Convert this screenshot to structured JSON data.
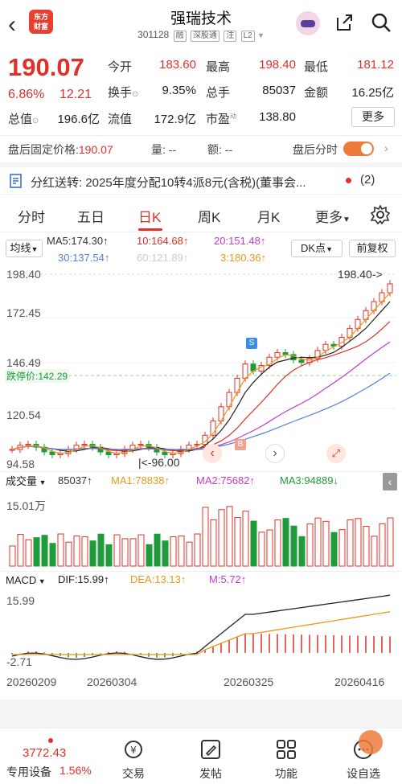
{
  "header": {
    "logo_text": "东方财富",
    "title": "强瑞技术",
    "code": "301128",
    "tags": [
      "融",
      "深股通",
      "注",
      "L2"
    ]
  },
  "quote": {
    "price": "190.07",
    "change_pct": "6.86%",
    "change_amt": "12.21",
    "open_label": "今开",
    "open": "183.60",
    "high_label": "最高",
    "high": "198.40",
    "low_label": "最低",
    "low": "181.12",
    "turnover_label": "换手",
    "turnover": "9.35%",
    "volume_label": "总手",
    "volume": "85037",
    "amount_label": "金额",
    "amount": "16.25亿",
    "mcap_label": "总值",
    "mcap": "196.6亿",
    "float_label": "流值",
    "float": "172.9亿",
    "pe_label": "市盈",
    "pe_sup": "动",
    "pe": "138.80",
    "more": "更多"
  },
  "after_hours": {
    "fixed_price_label": "盘后固定价格:",
    "fixed_price": "190.07",
    "vol_label": "量:",
    "vol": "--",
    "amt_label": "额:",
    "amt": "--",
    "timeshare_label": "盘后分时"
  },
  "notice": {
    "text": "分红送转: 2025年度分配10转4派8元(含税)(董事会...",
    "count": "(2)"
  },
  "tabs": [
    "分时",
    "五日",
    "日K",
    "周K",
    "月K",
    "更多"
  ],
  "ma": {
    "selector": "均线",
    "ma5": "MA5:174.30↑",
    "ma10": "10:164.68↑",
    "ma20": "20:151.48↑",
    "ma30": "30:137.54↑",
    "ma60": "60:121.89↑",
    "ma3": "3:180.36↑",
    "dk": "DK点",
    "adjust": "前复权"
  },
  "kline_axis": {
    "y_labels": [
      "198.40",
      "172.45",
      "146.49",
      "120.54",
      "94.58"
    ],
    "high_marker": "198.40->",
    "low_marker": "|<-96.00",
    "limit_price": "跌停价:142.29"
  },
  "volume": {
    "selector": "成交量",
    "value": "85037↑",
    "ma1": "MA1:78838↑",
    "ma2": "MA2:75682↑",
    "ma3": "MA3:94889↓",
    "max_label": "15.01万"
  },
  "macd": {
    "selector": "MACD",
    "dif": "DIF:15.99↑",
    "dea": "DEA:13.13↑",
    "m": "M:5.72↑",
    "top_label": "15.99",
    "bottom_label": "-2.71"
  },
  "dates": [
    "20260209",
    "20260304",
    "20260325",
    "20260416"
  ],
  "bottom_nav": {
    "index_value": "3772.43",
    "index_name": "专用设备",
    "index_pct": "1.56%",
    "items": [
      "交易",
      "发帖",
      "功能",
      "设自选"
    ]
  },
  "colors": {
    "up": "#e0302a",
    "down": "#1e9c3a",
    "accent": "#f07a3a"
  }
}
